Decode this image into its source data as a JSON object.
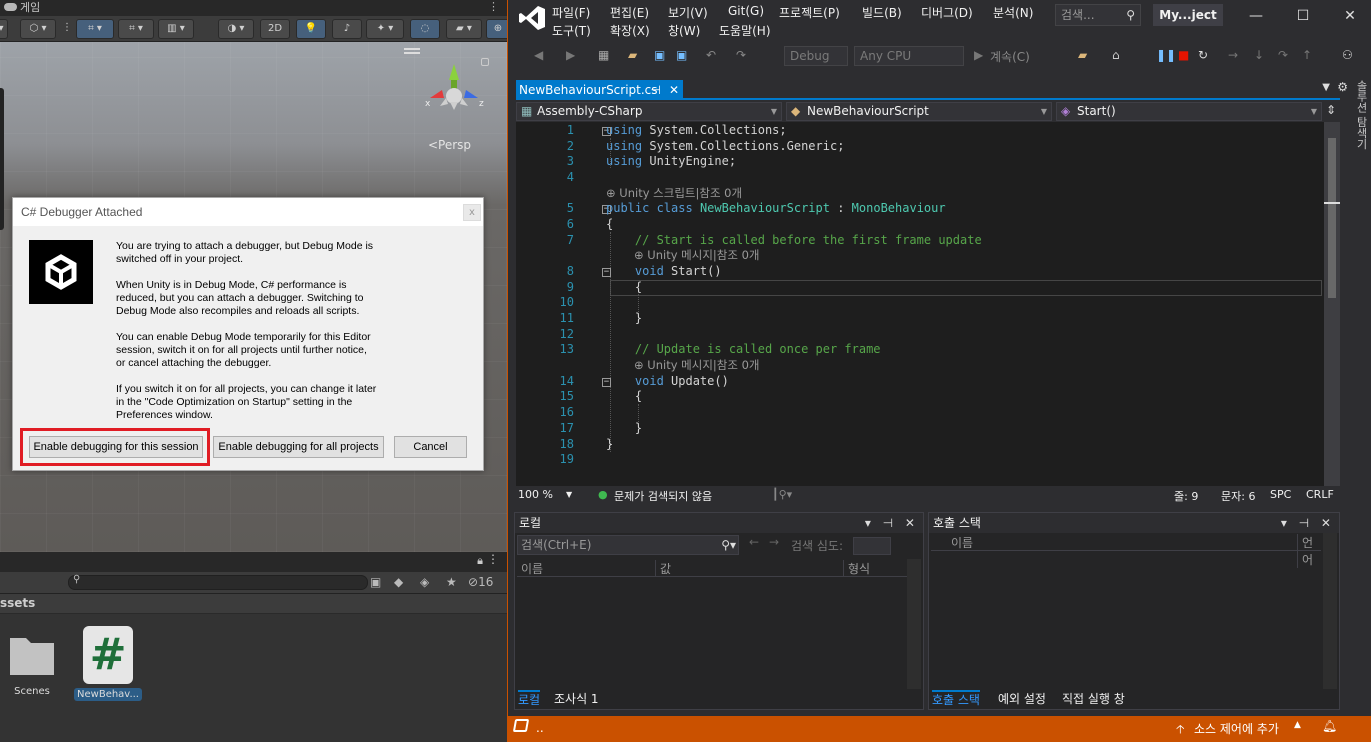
{
  "unity": {
    "tab_title": "게임",
    "toolbar": {
      "mode_2d": "2D"
    },
    "scene": {
      "persp_label": "<Persp",
      "gizmo_x": "x",
      "gizmo_z": "z"
    },
    "dialog": {
      "title": "C# Debugger Attached",
      "close": "x",
      "paragraphs": [
        "You are trying to attach a debugger, but Debug Mode is switched off in your project.",
        "When Unity is in Debug Mode, C# performance is reduced, but you can attach a debugger. Switching to Debug Mode also recompiles and reloads all scripts.",
        "You can enable Debug Mode temporarily for this Editor session, switch it on for all projects until further notice, or cancel attaching the debugger.",
        "If you switch it on for all projects, you can change it later in the \"Code Optimization on Startup\" setting in the Preferences window."
      ],
      "btn_session": "Enable debugging for this session",
      "btn_all": "Enable debugging for all projects",
      "btn_cancel": "Cancel"
    },
    "project": {
      "hidden_count": "16",
      "breadcrumb": "ssets",
      "assets": [
        {
          "label": "Scenes",
          "type": "folder"
        },
        {
          "label": "NewBehav...",
          "type": "script"
        }
      ],
      "script_glyph": "#"
    }
  },
  "vs": {
    "menu": [
      "파일(F)",
      "편집(E)",
      "보기(V)",
      "Git(G)",
      "프로젝트(P)",
      "빌드(B)",
      "디버그(D)",
      "분석(N)",
      "도구(T)",
      "확장(X)",
      "창(W)",
      "도움말(H)"
    ],
    "search_placeholder": "검색...",
    "solution_title": "My...ject",
    "toolbar": {
      "config": "Debug",
      "platform": "Any CPU",
      "continue": "계속(C)"
    },
    "side_tab": "솔루션 탐색기",
    "doc_tab": {
      "name": "NewBehaviourScript.cs",
      "pin": "⊣",
      "close": "✕"
    },
    "nav": {
      "project": "Assembly-CSharp",
      "class": "NewBehaviourScript",
      "member": "Start()"
    },
    "code_lines": [
      {
        "n": "1",
        "t": "using System.Collections;"
      },
      {
        "n": "2",
        "t": "using System.Collections.Generic;"
      },
      {
        "n": "3",
        "t": "using UnityEngine;"
      },
      {
        "n": "4",
        "t": ""
      },
      {
        "n": "",
        "t": "Unity 스크립트|참조 0개",
        "lens": true
      },
      {
        "n": "5",
        "t": "public class NewBehaviourScript : MonoBehaviour"
      },
      {
        "n": "6",
        "t": "{"
      },
      {
        "n": "7",
        "t": "    // Start is called before the first frame update"
      },
      {
        "n": "",
        "t": "Unity 메시지|참조 0개",
        "lens": true
      },
      {
        "n": "8",
        "t": "    void Start()"
      },
      {
        "n": "9",
        "t": "    {"
      },
      {
        "n": "10",
        "t": ""
      },
      {
        "n": "11",
        "t": "    }"
      },
      {
        "n": "12",
        "t": ""
      },
      {
        "n": "13",
        "t": "    // Update is called once per frame"
      },
      {
        "n": "",
        "t": "Unity 메시지|참조 0개",
        "lens": true
      },
      {
        "n": "14",
        "t": "    void Update()"
      },
      {
        "n": "15",
        "t": "    {"
      },
      {
        "n": "16",
        "t": ""
      },
      {
        "n": "17",
        "t": "    }"
      },
      {
        "n": "18",
        "t": "}"
      },
      {
        "n": "19",
        "t": ""
      }
    ],
    "status": {
      "zoom": "100 %",
      "issues": "문제가 검색되지 않음",
      "line": "줄: 9",
      "col": "문자: 6",
      "spc": "SPC",
      "crlf": "CRLF"
    },
    "locals": {
      "title": "로컬",
      "search_placeholder": "검색(Ctrl+E)",
      "search_depth": "검색 심도:",
      "cols": [
        "이름",
        "값",
        "형식"
      ]
    },
    "callstack": {
      "title": "호출 스택",
      "cols": [
        "이름",
        "언어"
      ]
    },
    "left_tabs": [
      "로컬",
      "조사식 1"
    ],
    "right_tabs": [
      "호출 스택",
      "예외 설정",
      "직접 실행 창"
    ],
    "statusbar": {
      "left": "..",
      "source_control": "소스 제어에 추가"
    }
  }
}
